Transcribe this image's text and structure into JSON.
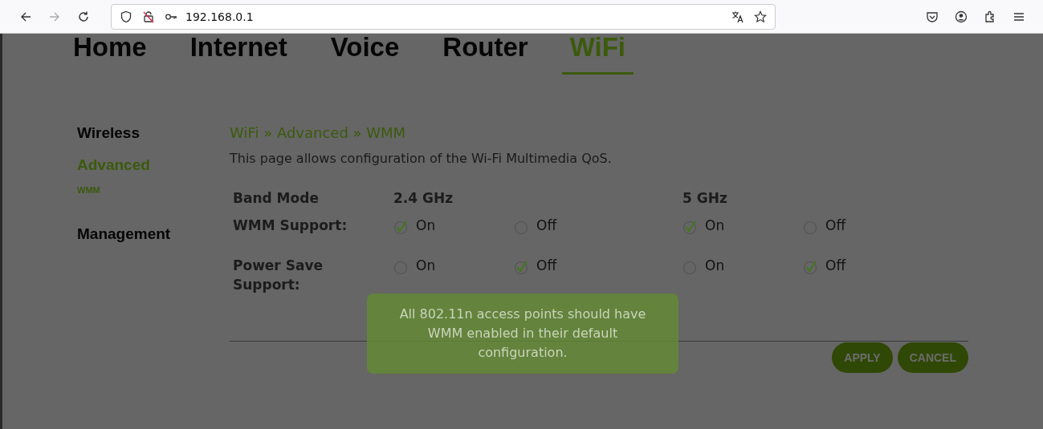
{
  "browser": {
    "url": "192.168.0.1"
  },
  "nav_tabs": [
    {
      "label": "Home",
      "selected": false
    },
    {
      "label": "Internet",
      "selected": false
    },
    {
      "label": "Voice",
      "selected": false
    },
    {
      "label": "Router",
      "selected": false
    },
    {
      "label": "WiFi",
      "selected": true
    }
  ],
  "sidebar": [
    {
      "label": "Wireless",
      "kind": "section",
      "selected": false
    },
    {
      "label": "Advanced",
      "kind": "section",
      "selected": true
    },
    {
      "label": "WMM",
      "kind": "sub",
      "selected": true
    },
    {
      "label": "Management",
      "kind": "section",
      "selected": false
    }
  ],
  "breadcrumb": "WiFi » Advanced » WMM",
  "description": "This page allows configuration of the Wi-Fi Multimedia QoS.",
  "table": {
    "header": {
      "label": "Band Mode",
      "bands": [
        "2.4 GHz",
        "5 GHz"
      ]
    },
    "rows": [
      {
        "label": "WMM Support:",
        "options": [
          {
            "label": "On",
            "selected": true
          },
          {
            "label": "Off",
            "selected": false
          },
          {
            "label": "On",
            "selected": true
          },
          {
            "label": "Off",
            "selected": false
          }
        ]
      },
      {
        "label": "Power Save Support:",
        "options": [
          {
            "label": "On",
            "selected": false
          },
          {
            "label": "Off",
            "selected": true
          },
          {
            "label": "On",
            "selected": false
          },
          {
            "label": "Off",
            "selected": true
          }
        ]
      }
    ]
  },
  "tooltip": "All 802.11n access points should have WMM enabled in their default configuration.",
  "buttons": [
    "APPLY",
    "CANCEL"
  ]
}
